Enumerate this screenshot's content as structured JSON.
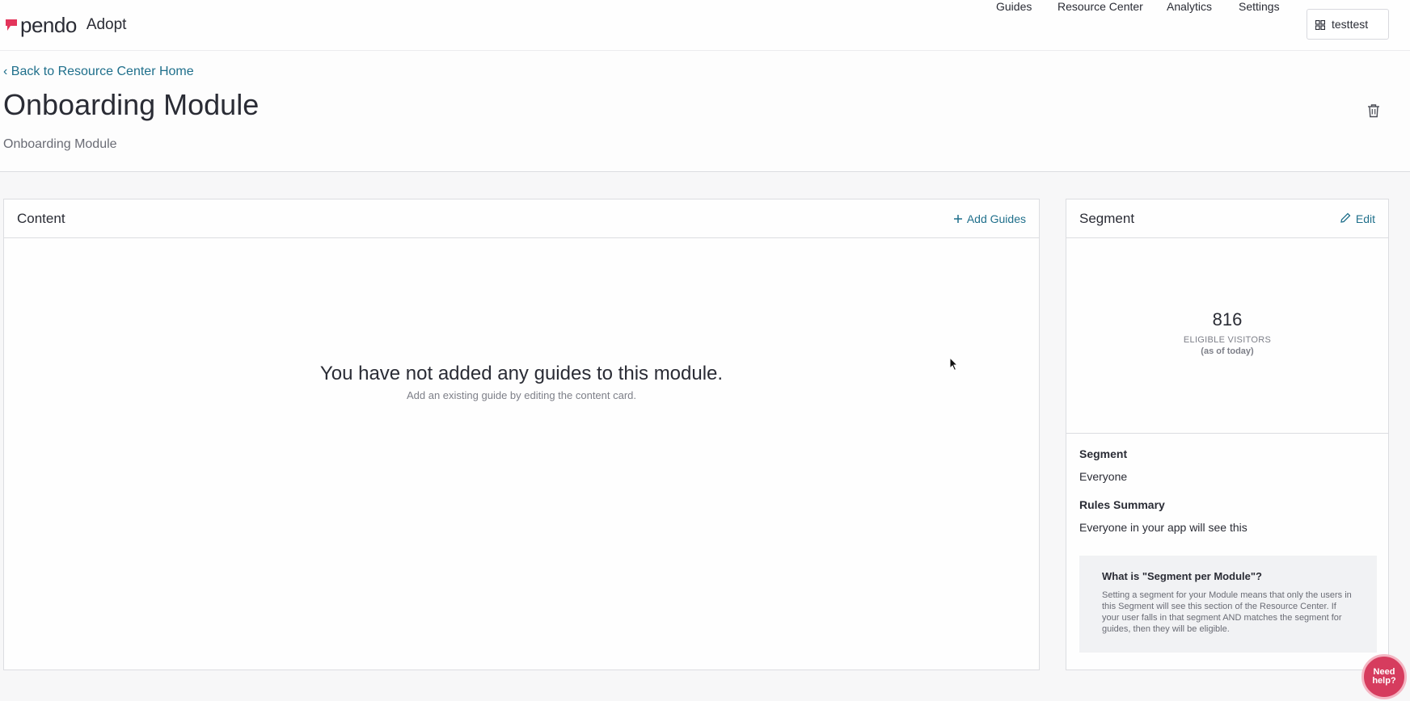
{
  "brand": {
    "name": "pendo",
    "product": "Adopt",
    "accent": "#e3355b"
  },
  "nav": {
    "links": [
      "Guides",
      "Resource Center",
      "Analytics",
      "Settings"
    ],
    "app_switcher_label": "testtest"
  },
  "header": {
    "back_link": "‹ Back to Resource Center Home",
    "title": "Onboarding Module",
    "subtitle": "Onboarding Module"
  },
  "content_card": {
    "title": "Content",
    "action_label": "Add Guides",
    "empty_title": "You have not added any guides to this module.",
    "empty_subtitle": "Add an existing guide by editing the content card."
  },
  "segment_card": {
    "title": "Segment",
    "action_label": "Edit",
    "visitors_count": "816",
    "visitors_label": "ELIGIBLE VISITORS",
    "visitors_note": "(as of today)",
    "segment_label": "Segment",
    "segment_value": "Everyone",
    "rules_label": "Rules Summary",
    "rules_value": "Everyone in your app will see this",
    "info_title": "What is \"Segment per Module\"?",
    "info_body": "Setting a segment for your Module means that only the users in this Segment will see this section of the Resource Center. If your user falls in that segment AND matches the segment for guides, then they will be eligible."
  },
  "help_button": {
    "line1": "Need",
    "line2": "help?"
  },
  "colors": {
    "link": "#1f6f8b",
    "help": "#d63c5e"
  }
}
